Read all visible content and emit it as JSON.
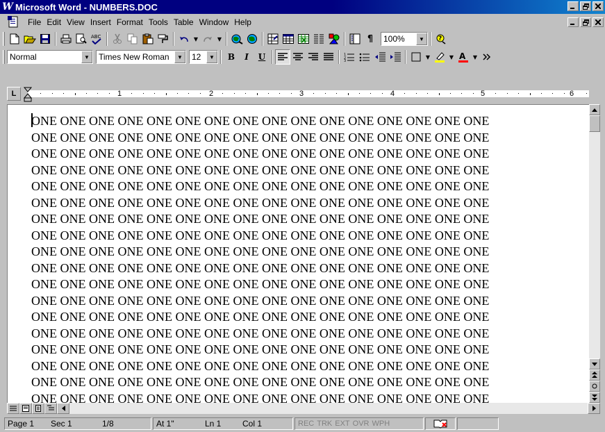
{
  "window": {
    "title": "Microsoft Word - NUMBERS.DOC",
    "app_icon": "W",
    "controls": {
      "minimize": "_",
      "restore": "▭",
      "close": "×"
    }
  },
  "menubar": {
    "items": [
      "File",
      "Edit",
      "View",
      "Insert",
      "Format",
      "Tools",
      "Table",
      "Window",
      "Help"
    ]
  },
  "standard_toolbar": {
    "zoom": "100%"
  },
  "format_toolbar": {
    "style": "Normal",
    "font": "Times New Roman",
    "size": "12",
    "bold": "B",
    "italic": "I",
    "underline": "U"
  },
  "ruler": {
    "tab_selector": "L",
    "numbers": [
      "1",
      "2",
      "3",
      "4",
      "5",
      "6"
    ]
  },
  "document": {
    "word": "ONE",
    "lines": 19
  },
  "statusbar": {
    "page": "Page 1",
    "sec": "Sec 1",
    "pages": "1/8",
    "at": "At 1\"",
    "ln": "Ln 1",
    "col": "Col 1",
    "modes": [
      "REC",
      "TRK",
      "EXT",
      "OVR",
      "WPH"
    ]
  },
  "colors": {
    "titlebar": "#000080",
    "face": "#c0c0c0"
  }
}
